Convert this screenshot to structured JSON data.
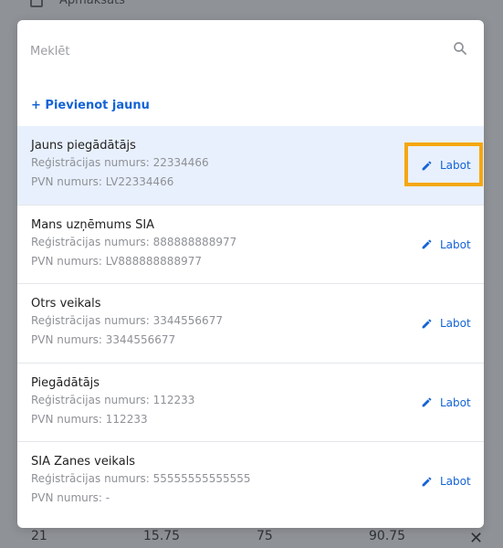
{
  "background": {
    "top_label": "Apmaksāts",
    "bottom_row": [
      "21",
      "15.75",
      "75",
      "90.75"
    ]
  },
  "search": {
    "placeholder": "Meklēt",
    "value": ""
  },
  "add_new_label": "+ Pievienot jaunu",
  "edit_label": "Labot",
  "items": [
    {
      "name": "Jauns piegādātājs",
      "reg": "Reģistrācijas numurs: 22334466",
      "vat": "PVN numurs: LV22334466",
      "selected": true
    },
    {
      "name": "Mans uzņēmums SIA",
      "reg": "Reģistrācijas numurs: 888888888977",
      "vat": "PVN numurs: LV888888888977",
      "selected": false
    },
    {
      "name": "Otrs veikals",
      "reg": "Reģistrācijas numurs: 3344556677",
      "vat": "PVN numurs: 3344556677",
      "selected": false
    },
    {
      "name": "Piegādātājs",
      "reg": "Reģistrācijas numurs: 112233",
      "vat": "PVN numurs: 112233",
      "selected": false
    },
    {
      "name": "SIA Zanes veikals",
      "reg": "Reģistrācijas numurs: 55555555555555",
      "vat": "PVN numurs: -",
      "selected": false
    }
  ],
  "colors": {
    "accent": "#1463d6",
    "highlight": "#f5a70f",
    "selected_row": "#e8f0fd"
  }
}
